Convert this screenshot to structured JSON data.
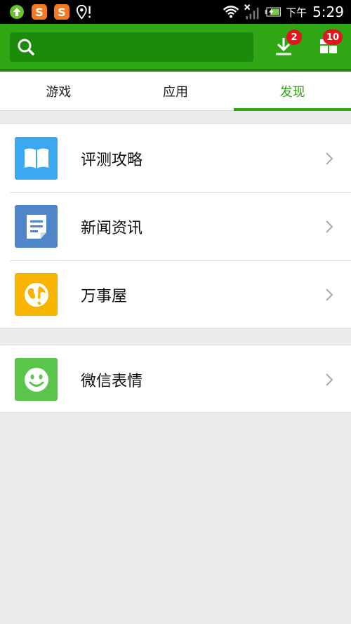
{
  "status_bar": {
    "ampm": "下午",
    "time": "5:29"
  },
  "header": {
    "search_placeholder": "",
    "download_badge": "2",
    "apps_badge": "10"
  },
  "tabs": [
    {
      "label": "游戏",
      "active": false
    },
    {
      "label": "应用",
      "active": false
    },
    {
      "label": "发现",
      "active": true
    }
  ],
  "groups": [
    {
      "items": [
        {
          "label": "评测攻略",
          "icon": "book-icon",
          "color": "#3aa9f0"
        },
        {
          "label": "新闻资讯",
          "icon": "document-icon",
          "color": "#4f86c8"
        },
        {
          "label": "万事屋",
          "icon": "globe-icon",
          "color": "#f7b500"
        }
      ]
    },
    {
      "items": [
        {
          "label": "微信表情",
          "icon": "smiley-icon",
          "color": "#5ac54b"
        }
      ]
    }
  ],
  "colors": {
    "brand_green": "#2fa714",
    "badge_red": "#e5141d"
  }
}
